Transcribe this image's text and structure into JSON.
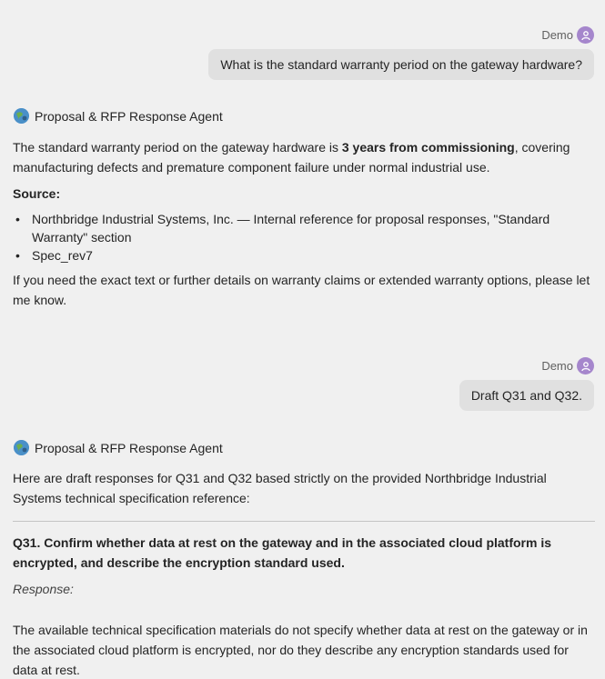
{
  "messages": {
    "user1": {
      "name": "Demo",
      "text": "What is the standard warranty period on the gateway hardware?"
    },
    "agent1": {
      "name": "Proposal & RFP Response Agent",
      "intro_pre": "The standard warranty period on the gateway hardware is ",
      "intro_bold": "3 years from commissioning",
      "intro_post": ", covering manufacturing defects and premature component failure under normal industrial use.",
      "source_label": "Source:",
      "sources": [
        "Northbridge Industrial Systems, Inc. — Internal reference for proposal responses, \"Standard Warranty\" section",
        "Spec_rev7"
      ],
      "closing": "If you need the exact text or further details on warranty claims or extended warranty options, please let me know."
    },
    "user2": {
      "name": "Demo",
      "text": "Draft Q31 and Q32."
    },
    "agent2": {
      "name": "Proposal & RFP Response Agent",
      "intro": "Here are draft responses for Q31 and Q32 based strictly on the provided Northbridge Industrial Systems technical specification reference:",
      "q31_title": "Q31. Confirm whether data at rest on the gateway and in the associated cloud platform is encrypted, and describe the encryption standard used.",
      "response_label": "Response:",
      "q31_answer": "The available technical specification materials do not specify whether data at rest on the gateway or in the associated cloud platform is encrypted, nor do they describe any encryption standards used for data at rest."
    }
  },
  "icons": {
    "user_avatar": "person-icon",
    "agent_logo": "agent-globe-icon"
  },
  "colors": {
    "background": "#f0f0f0",
    "user_bubble": "#e0e0e0",
    "avatar": "#a586cc",
    "divider": "#c4c4c4"
  }
}
